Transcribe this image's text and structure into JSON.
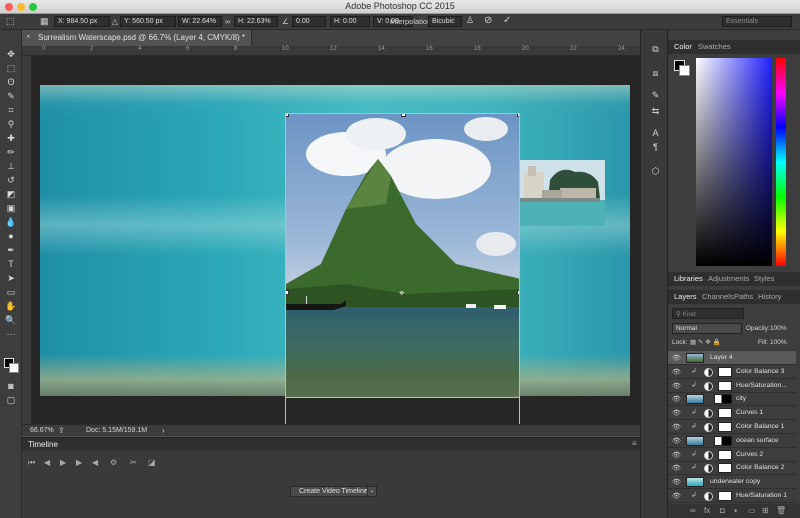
{
  "app": {
    "title": "Adobe Photoshop CC 2015"
  },
  "options": {
    "x": "X: 984.50 px",
    "y": "Y: 560.50 px",
    "w": "W: 22.64%",
    "h": "H: 22.63%",
    "angle": "0.00",
    "hskew": "H: 0.00",
    "vskew": "V: 0.00",
    "interpolation_label": "Interpolation:",
    "interpolation_value": "Bicubic",
    "workspace": "Essentials"
  },
  "document": {
    "tab": "Surrealism Waterscape.psd @ 66.7% (Layer 4, CMYK/8) *"
  },
  "ruler": {
    "marks": [
      "0",
      "2",
      "4",
      "6",
      "8",
      "10",
      "12",
      "14",
      "16",
      "18",
      "20",
      "22",
      "24"
    ]
  },
  "status": {
    "zoom": "66.67%",
    "doc": "Doc: 5.15M/159.1M"
  },
  "timeline": {
    "tab": "Timeline",
    "create_button": "Create Video Timeline"
  },
  "color_panel": {
    "tabs": [
      "Color",
      "Swatches"
    ]
  },
  "lib_panel": {
    "tabs": [
      "Libraries",
      "Adjustments",
      "Styles"
    ]
  },
  "layers_panel": {
    "tabs": [
      "Layers",
      "Channels",
      "Paths",
      "History"
    ],
    "search_placeholder": "Kind",
    "blend_mode": "Normal",
    "opacity_label": "Opacity:",
    "opacity_value": "100%",
    "lock_label": "Lock:",
    "fill_label": "Fill:",
    "fill_value": "100%",
    "layers": [
      {
        "name": "Layer 4",
        "kind": "pixel",
        "selected": true
      },
      {
        "name": "Color Balance 3",
        "kind": "adjustment"
      },
      {
        "name": "Hue/Saturation...",
        "kind": "adjustment"
      },
      {
        "name": "city",
        "kind": "pixel-mask"
      },
      {
        "name": "Curves 1",
        "kind": "adjustment"
      },
      {
        "name": "Color Balance 1",
        "kind": "adjustment"
      },
      {
        "name": "ocean surface",
        "kind": "pixel-mask"
      },
      {
        "name": "Curves 2",
        "kind": "adjustment"
      },
      {
        "name": "Color Balance 2",
        "kind": "adjustment"
      },
      {
        "name": "underwater copy",
        "kind": "pixel"
      },
      {
        "name": "Hue/Saturation 1",
        "kind": "adjustment"
      }
    ]
  },
  "colors": {
    "accent": "#5a5a5a",
    "fg_swatch": "#000000",
    "bg_swatch": "#ffffff"
  }
}
